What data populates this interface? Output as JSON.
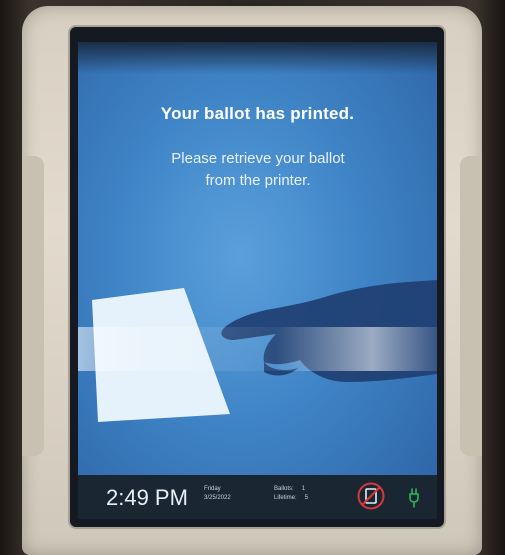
{
  "screen": {
    "title": "Your ballot has printed.",
    "message_line1": "Please retrieve your ballot",
    "message_line2": "from the printer."
  },
  "status_bar": {
    "time": "2:49 PM",
    "day": "Friday",
    "date": "3/25/2022",
    "ballots_label": "Ballots:",
    "ballots_value": "1",
    "lifetime_label": "Lifetime:",
    "lifetime_value": "5",
    "printer_icon": "printer-no-paper-icon",
    "power_icon": "power-plug-icon"
  },
  "colors": {
    "screen_blue": "#3f84c6",
    "status_bar": "#1b2633",
    "alert_red": "#d23a3a",
    "power_green": "#2fb55a"
  }
}
